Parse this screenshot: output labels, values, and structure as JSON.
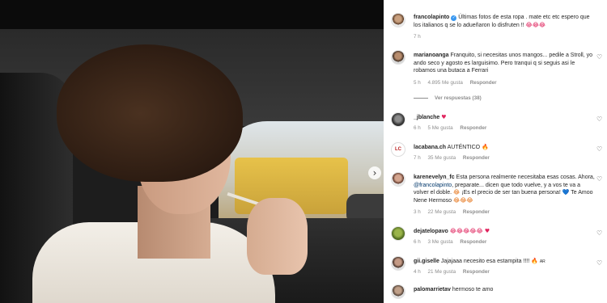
{
  "post": {
    "carousel_next": "›"
  },
  "icons": {
    "like": "♡",
    "verified": "✓"
  },
  "colors": {
    "link": "#00376b",
    "meta": "#8e8e8e",
    "verified": "#3897f0"
  },
  "caption": {
    "username": "francolapinto",
    "text": "Últimas fotos de esta ropa . mate etc etc espero que los italianos q se lo adueñaron lo disfruten !!",
    "emojis": "😂😂😂",
    "time": "7 h"
  },
  "comments": [
    {
      "username": "marianoanga",
      "text": "Franquito, si necesitas unos mangos... pedile a Stroll, yo ando seco y agosto es larguisimo. Pero tranqui q si seguis asi le robamos una butaca a Ferrari",
      "time": "5 h",
      "likes": "4.895 Me gusta",
      "reply": "Responder",
      "view_replies": "Ver respuestas (38)"
    },
    {
      "username": "_jblanche",
      "text": "",
      "emojis": "♥",
      "time": "6 h",
      "likes": "5 Me gusta",
      "reply": "Responder"
    },
    {
      "username": "lacabana.ch",
      "text": "AUTÉNTICO",
      "emojis": "🔥",
      "time": "7 h",
      "likes": "35 Me gusta",
      "reply": "Responder",
      "avatar_text": "LC"
    },
    {
      "username": "karenevelyn_fc",
      "text_1": "Esta persona realmente necesitaba esas cosas. Ahora,",
      "mention": "@francolapinto",
      "text_2": ", preparate... dicen que todo vuelve, y a vos te va a volver el doble.",
      "emoji_mid": "😂",
      "text_3": "¡Es el precio de ser tan buena persona!",
      "emoji_heart": "💙",
      "text_4": "Te Amoo Nene Hermoso",
      "emojis_end": "😂😂😂",
      "time": "3 h",
      "likes": "22 Me gusta",
      "reply": "Responder"
    },
    {
      "username": "dejatelopavo",
      "text": "",
      "emojis": "😂😂😂😂😂 ♥",
      "time": "6 h",
      "likes": "3 Me gusta",
      "reply": "Responder"
    },
    {
      "username": "gii.giselle",
      "text": "Jajajaaa necesito esa estampita !!!!",
      "emojis": "🔥",
      "flag": "AR",
      "time": "4 h",
      "likes": "21 Me gusta",
      "reply": "Responder"
    },
    {
      "username": "palomarrietav",
      "text": "hermoso te amo",
      "time": "",
      "likes": "",
      "reply": ""
    }
  ]
}
